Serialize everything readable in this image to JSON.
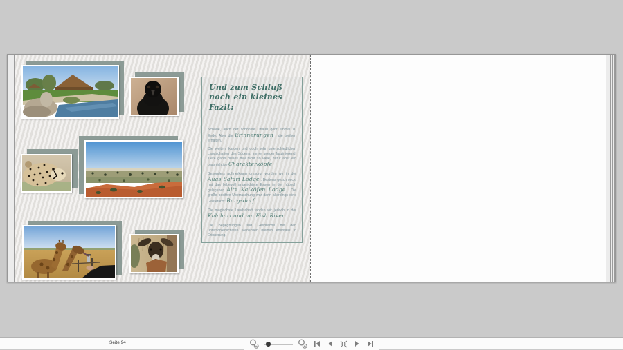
{
  "window": {
    "background_color": "#cacaca"
  },
  "statusbar": {
    "page_label": "Seite 94"
  },
  "toolbar": {
    "controls": [
      {
        "name": "zoom-out-icon"
      },
      {
        "name": "zoom-slider"
      },
      {
        "name": "zoom-in-icon"
      },
      {
        "name": "first-page-icon"
      },
      {
        "name": "previous-page-icon"
      },
      {
        "name": "fit-page-icon"
      },
      {
        "name": "next-page-icon"
      },
      {
        "name": "last-page-icon"
      }
    ]
  },
  "colors": {
    "accent_teal": "#3f6e66",
    "body_text": "#7d939b",
    "photo_backing_sage": "#8c9b96",
    "textbox_border": "#84a09a"
  },
  "book": {
    "left_page": {
      "photos": [
        {
          "alt": "safari lodge with thatched roof, lawn, rocks and pond"
        },
        {
          "alt": "black bird portrait on tan background"
        },
        {
          "alt": "cheetah head in profile"
        },
        {
          "alt": "kalahari landscape with red sand dune and scrub"
        },
        {
          "alt": "giraffes being fed at a fence"
        },
        {
          "alt": "antelope face with large ears"
        }
      ],
      "textbox": {
        "title": "Und zum Schluß noch ein kleines Fazit:",
        "paragraphs": [
          {
            "runs": [
              {
                "t": "Schade,  auch der schönste Urlaub geht einmal zu Ende. Aber die ",
                "s": "body"
              },
              {
                "t": "Erinnerungen",
                "s": "accent"
              },
              {
                "t": " , die bleiben erhalten.",
                "s": "body"
              }
            ]
          },
          {
            "runs": [
              {
                "t": "Die weiten, kargen und doch  sehr unterschiedlichen Landschaften des Südens: immer wieder faszinierend. Tiere gab's dieses mal nicht so viele, dafür aber ein paar richtige ",
                "s": "body"
              },
              {
                "t": "Charakterköpfe.",
                "s": "accent"
              }
            ]
          },
          {
            "runs": [
              {
                "t": "Besonders aufmerksam umsorgt wurden wir in der ",
                "s": "body"
              },
              {
                "t": "Auas Safari Lodge",
                "s": "accent"
              },
              {
                "t": " . Bestens geschmeckt hat das liebevoll angerichtete Essen  in der hübsch gelegenen ",
                "s": "body"
              },
              {
                "t": "Alte Kalköfen Lodge",
                "s": "accent"
              },
              {
                "t": " . Die große positive Überraschung war dann allerdings eine Gästefarm: ",
                "s": "body"
              },
              {
                "t": "Burgsdorf.",
                "s": "accent"
              }
            ]
          },
          {
            "runs": [
              {
                "t": "Die magischste Landschaft fanden wir jedoch in der ",
                "s": "body"
              },
              {
                "t": "Kalahari und am Fish River.",
                "s": "accent"
              }
            ]
          },
          {
            "runs": [
              {
                "t": "Die Begegnungen und Gespräche mit den unterschiedlichsten Menschen bleiben ebenfalls in Erinnerung.",
                "s": "body"
              }
            ]
          }
        ]
      }
    },
    "right_page": {
      "content": ""
    }
  }
}
